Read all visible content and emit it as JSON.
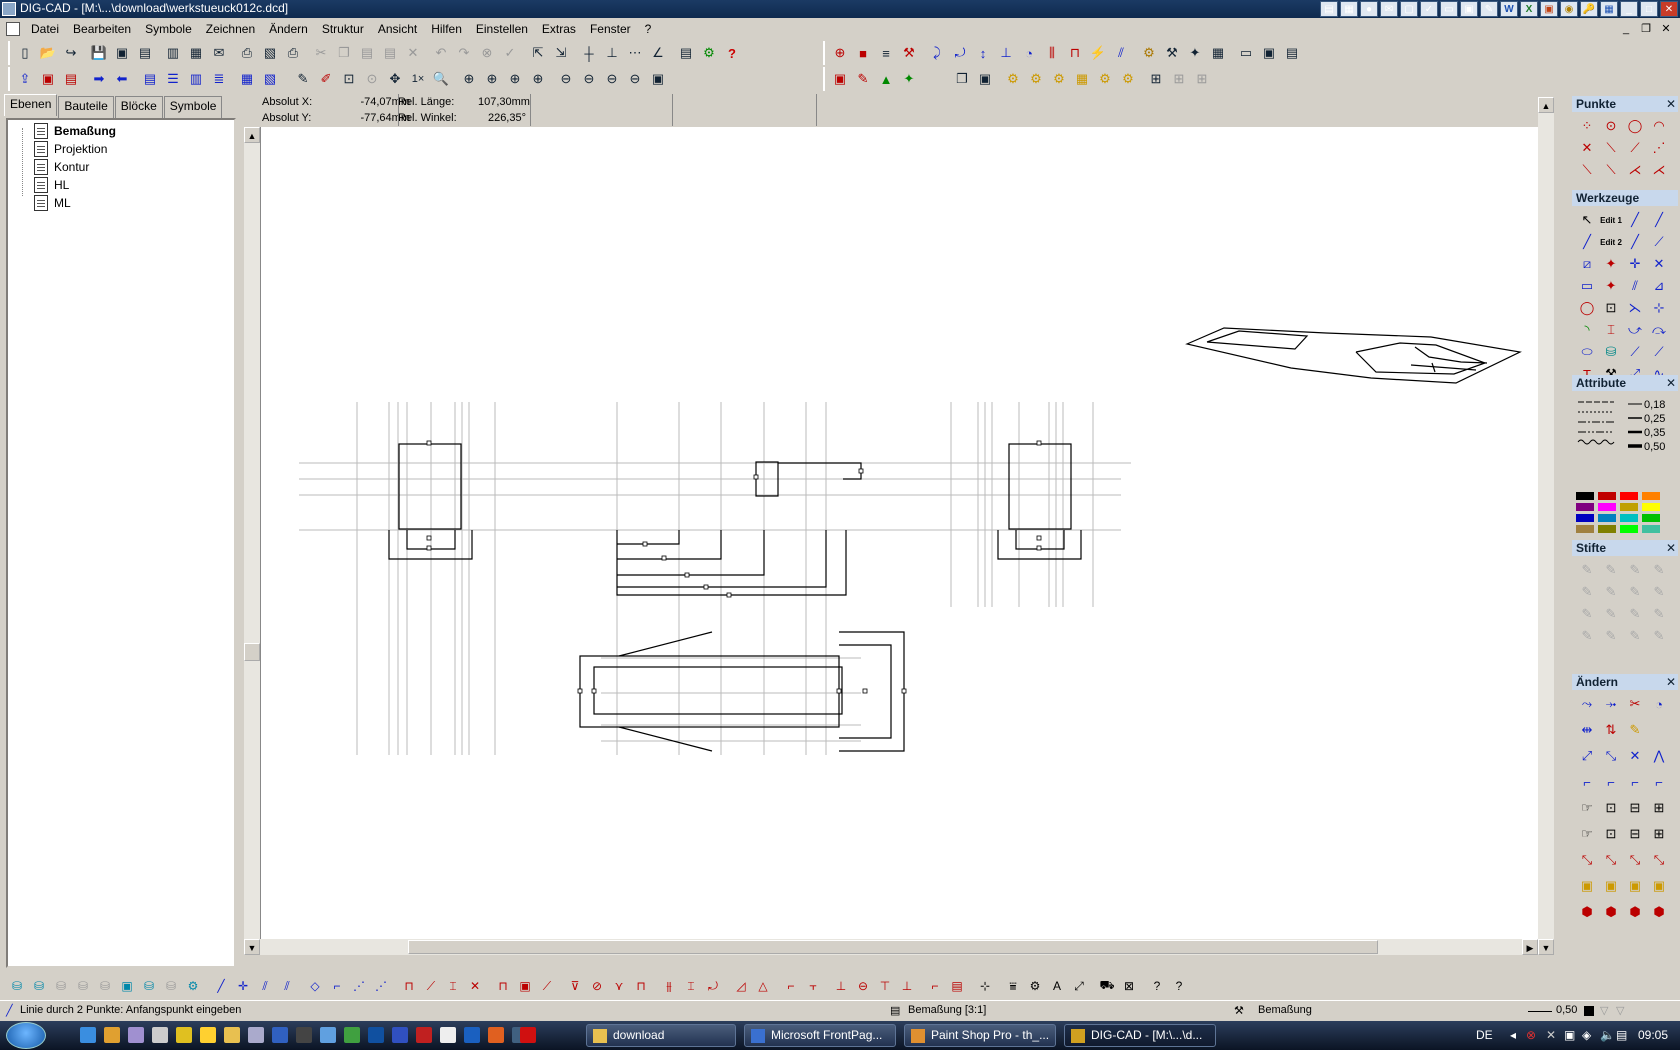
{
  "window": {
    "title": "DIG-CAD - [M:\\...\\download\\werkstueuck012c.dcd]"
  },
  "menu": [
    "Datei",
    "Bearbeiten",
    "Symbole",
    "Zeichnen",
    "Ändern",
    "Struktur",
    "Ansicht",
    "Hilfen",
    "Einstellen",
    "Extras",
    "Fenster",
    "?"
  ],
  "left_tabs": [
    "Ebenen",
    "Bauteile",
    "Blöcke",
    "Symbole"
  ],
  "layers": [
    "Bemaßung",
    "Projektion",
    "Kontur",
    "HL",
    "ML"
  ],
  "coords": {
    "abs_x_label": "Absolut X:",
    "abs_x": "-74,07mm",
    "abs_y_label": "Absolut Y:",
    "abs_y": "-77,64mm",
    "rel_len_label": "Rel. Länge:",
    "rel_len": "107,30mm",
    "rel_angle_label": "Rel. Winkel:",
    "rel_angle": "226,35°"
  },
  "right_panel": {
    "punkte": "Punkte",
    "werkzeuge": "Werkzeuge",
    "attribute": "Attribute",
    "stifte": "Stifte",
    "aendern": "Ändern",
    "line_widths": [
      "0,18",
      "0,25",
      "0,35",
      "0,50"
    ],
    "edit1": "Edit 1",
    "edit2": "Edit 2"
  },
  "status": {
    "hint": "Linie durch 2 Punkte: Anfangspunkt eingeben",
    "layer_scale": "Bemaßung [3:1]",
    "layer": "Bemaßung",
    "pen": "0,50"
  },
  "taskbar": {
    "tasks": [
      "download",
      "Microsoft FrontPag...",
      "Paint Shop Pro - th_...",
      "DIG-CAD - [M:\\...\\d..."
    ],
    "lang": "DE",
    "clock": "09:05"
  },
  "colors": {
    "accent": "#c8d8ec",
    "swatches": [
      "#000000",
      "#c00000",
      "#ff0000",
      "#ff8000",
      "#800080",
      "#ff00ff",
      "#c0a000",
      "#ffff00",
      "#0000c0",
      "#0080c0",
      "#00c0c0",
      "#00c000",
      "#a08040",
      "#808000",
      "#00ff00",
      "#40c0a0"
    ]
  }
}
